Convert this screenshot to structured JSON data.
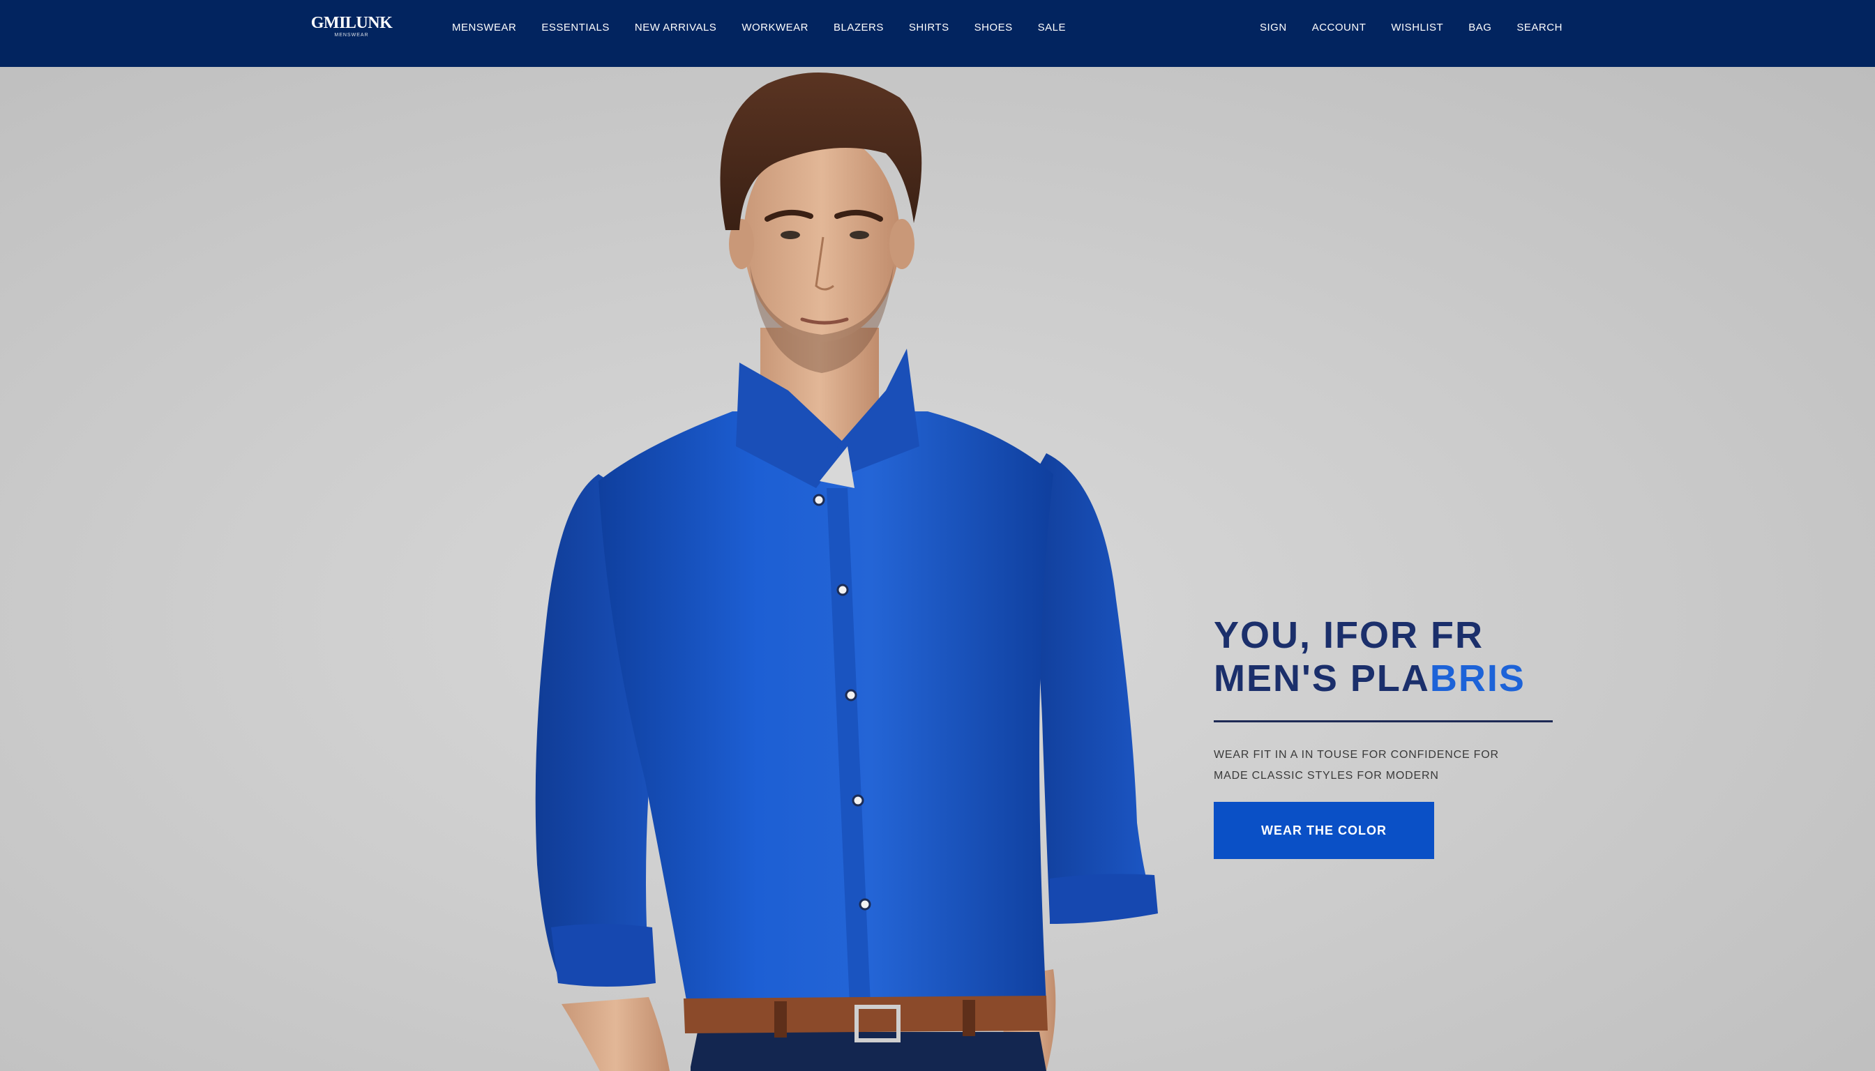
{
  "header": {
    "logo_text": "GMILUNK",
    "logo_tagline": "MENSWEAR",
    "nav_left": [
      "MENSWEAR",
      "ESSENTIALS",
      "NEW ARRIVALS",
      "WORKWEAR",
      "BLAZERS",
      "SHIRTS",
      "SHOES",
      "SALE"
    ],
    "nav_right": [
      "SIGN",
      "ACCOUNT",
      "WISHLIST",
      "BAG",
      "SEARCH"
    ]
  },
  "hero": {
    "image_alt": "Male model wearing a royal blue long-sleeve dress shirt with a brown leather belt",
    "headline_line1": "YOU, IFOR FR",
    "headline_line2_dark": "MEN'S PLA",
    "headline_line2_accent": "BRIS",
    "subtext_line1": "WEAR FIT IN A IN TOUSE FOR CONFIDENCE FOR",
    "subtext_line2": "MADE CLASSIC STYLES FOR MODERN",
    "cta_label": "WEAR THE COLOR"
  },
  "colors": {
    "navbar": "#02245f",
    "headline": "#1b2f6b",
    "accent": "#1d63d8",
    "cta": "#0a50c6",
    "shirt": "#1a55c8"
  }
}
